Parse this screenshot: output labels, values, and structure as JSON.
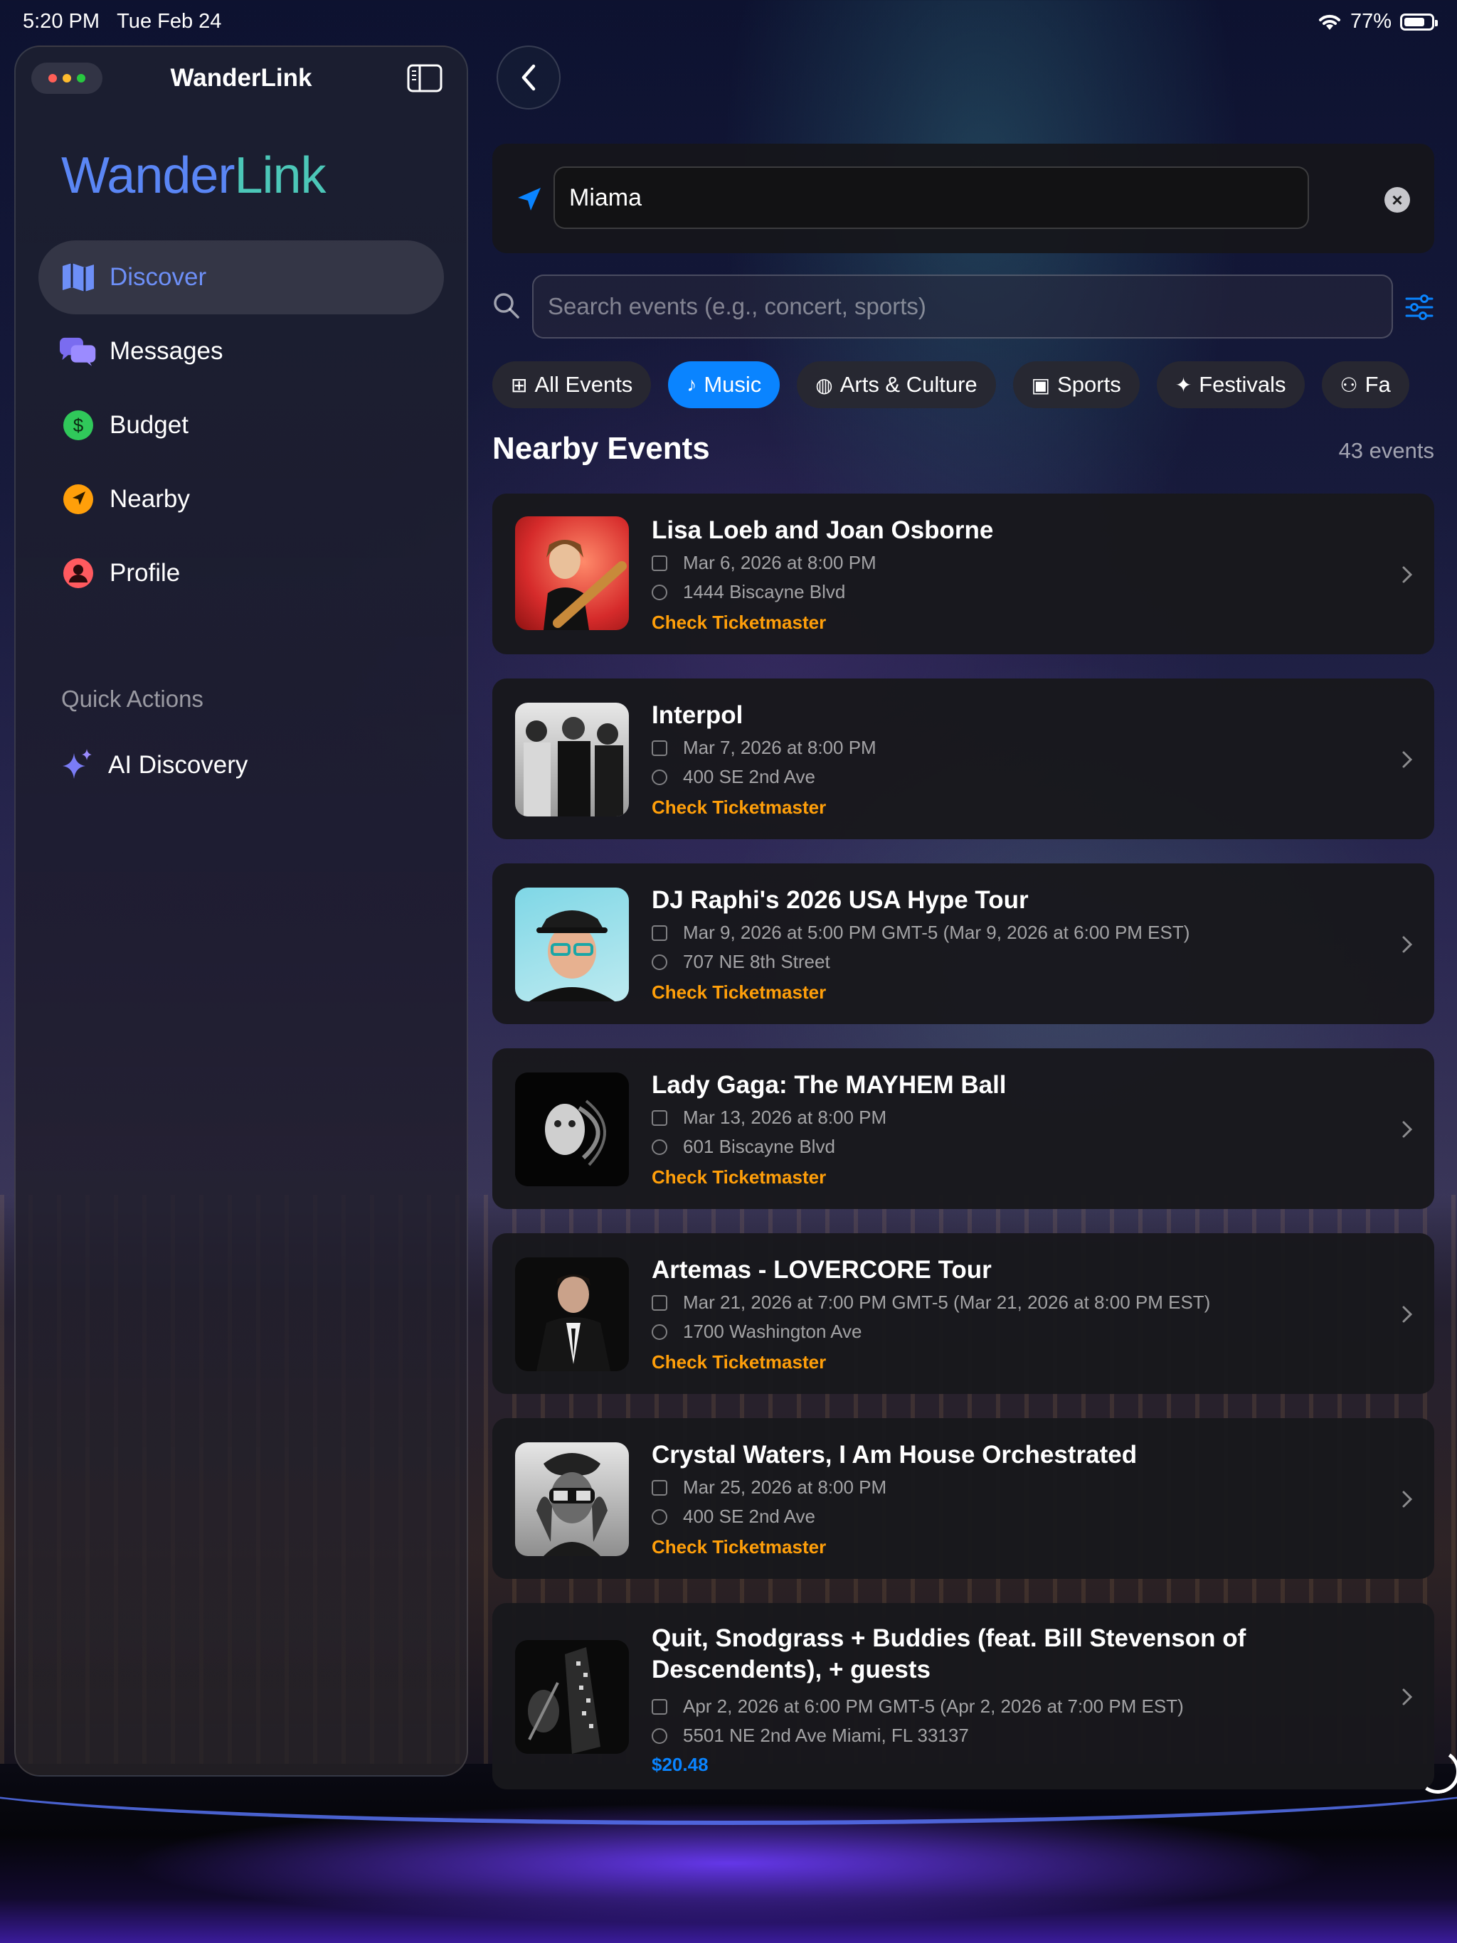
{
  "status_bar": {
    "time": "5:20 PM",
    "date": "Tue Feb 24",
    "battery": "77%",
    "battery_level": 0.77,
    "wifi_icon": "wifi-icon"
  },
  "sidebar": {
    "window_title": "WanderLink",
    "brand_part1": "Wander",
    "brand_part2": "Link",
    "toggle_icon": "sidebar-toggle-icon",
    "nav": [
      {
        "label": "Discover",
        "icon": "map-icon",
        "active": true
      },
      {
        "label": "Messages",
        "icon": "chat-bubbles-icon",
        "active": false
      },
      {
        "label": "Budget",
        "icon": "dollar-icon",
        "active": false
      },
      {
        "label": "Nearby",
        "icon": "location-arrow-icon",
        "active": false
      },
      {
        "label": "Profile",
        "icon": "person-icon",
        "active": false
      }
    ],
    "quick_actions_label": "Quick Actions",
    "quick_actions": [
      {
        "label": "AI Discovery",
        "icon": "sparkles-icon"
      }
    ]
  },
  "main": {
    "location_value": "Miama",
    "search_placeholder": "Search events (e.g., concert, sports)",
    "categories": [
      {
        "label": "All Events",
        "icon": "grid-icon",
        "active": false
      },
      {
        "label": "Music",
        "icon": "music-note-icon",
        "active": true
      },
      {
        "label": "Arts & Culture",
        "icon": "palette-icon",
        "active": false
      },
      {
        "label": "Sports",
        "icon": "ticket-icon",
        "active": false
      },
      {
        "label": "Festivals",
        "icon": "sparkle-icon",
        "active": false
      },
      {
        "label": "Fa",
        "icon": "family-icon",
        "active": false
      }
    ],
    "section_title": "Nearby Events",
    "event_count": "43 events",
    "events": [
      {
        "title": "Lisa Loeb and Joan Osborne",
        "date": "Mar 6, 2026 at 8:00 PM",
        "venue": "1444 Biscayne Blvd",
        "link": "Check Ticketmaster"
      },
      {
        "title": "Interpol",
        "date": "Mar 7, 2026 at 8:00 PM",
        "venue": "400 SE 2nd Ave",
        "link": "Check Ticketmaster"
      },
      {
        "title": "DJ Raphi's 2026 USA Hype Tour",
        "date": "Mar 9, 2026 at 5:00 PM GMT-5 (Mar 9, 2026 at 6:00 PM EST)",
        "venue": "707 NE 8th Street",
        "link": "Check Ticketmaster"
      },
      {
        "title": "Lady Gaga: The MAYHEM Ball",
        "date": "Mar 13, 2026 at 8:00 PM",
        "venue": "601 Biscayne Blvd",
        "link": "Check Ticketmaster"
      },
      {
        "title": "Artemas - LOVERCORE Tour",
        "date": "Mar 21, 2026 at 7:00 PM GMT-5 (Mar 21, 2026 at 8:00 PM EST)",
        "venue": "1700 Washington Ave",
        "link": "Check Ticketmaster"
      },
      {
        "title": "Crystal Waters, I Am House Orchestrated",
        "date": "Mar 25, 2026 at 8:00 PM",
        "venue": "400 SE 2nd Ave",
        "link": "Check Ticketmaster"
      },
      {
        "title": "Quit, Snodgrass + Buddies (feat. Bill Stevenson of Descendents), + guests",
        "date": "Apr 2, 2026 at 6:00 PM GMT-5 (Apr 2, 2026 at 7:00 PM EST)",
        "venue": "5501 NE 2nd Ave Miami, FL 33137",
        "price": "$20.48"
      }
    ]
  },
  "colors": {
    "accent": "#0a84ff",
    "ticket_link": "#ff9f0a",
    "brand_blue": "#5a86f5",
    "brand_teal": "#4cc7b8"
  }
}
